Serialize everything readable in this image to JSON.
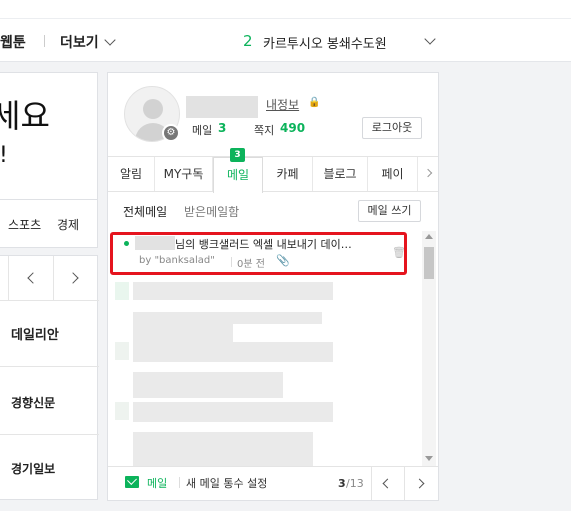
{
  "topnav": {
    "webtoon": "웹툰",
    "more": "더보기",
    "weather_num": "2",
    "weather_text": "카르투시오 봉쇄수도원"
  },
  "left": {
    "headline": "세요",
    "subline": "!",
    "tabs": [
      "스포츠",
      "경제"
    ],
    "papers": [
      "데일리안",
      "경향신문",
      "경기일보"
    ]
  },
  "profile": {
    "my_info": "내정보",
    "mail_label": "메일",
    "mail_count": "3",
    "note_label": "쪽지",
    "note_count": "490",
    "logout": "로그아웃"
  },
  "tabs": [
    {
      "label": "알림"
    },
    {
      "label": "MY구독"
    },
    {
      "label": "메일",
      "badge": "3"
    },
    {
      "label": "카페"
    },
    {
      "label": "블로그"
    },
    {
      "label": "페이"
    }
  ],
  "mail": {
    "filter_all": "전체메일",
    "filter_received": "받은메일함",
    "compose": "메일 쓰기",
    "first_subject": "님의 뱅크샐러드 엑셀 내보내기 데이…",
    "first_sender": "by \"banksalad\"",
    "first_time": "0분 전"
  },
  "footer": {
    "mail": "메일",
    "settings": "새 메일 통수 설정",
    "page_current": "3",
    "page_total": "/13"
  },
  "colors": {
    "accent": "#0cb35b",
    "highlight": "#e5141e"
  }
}
